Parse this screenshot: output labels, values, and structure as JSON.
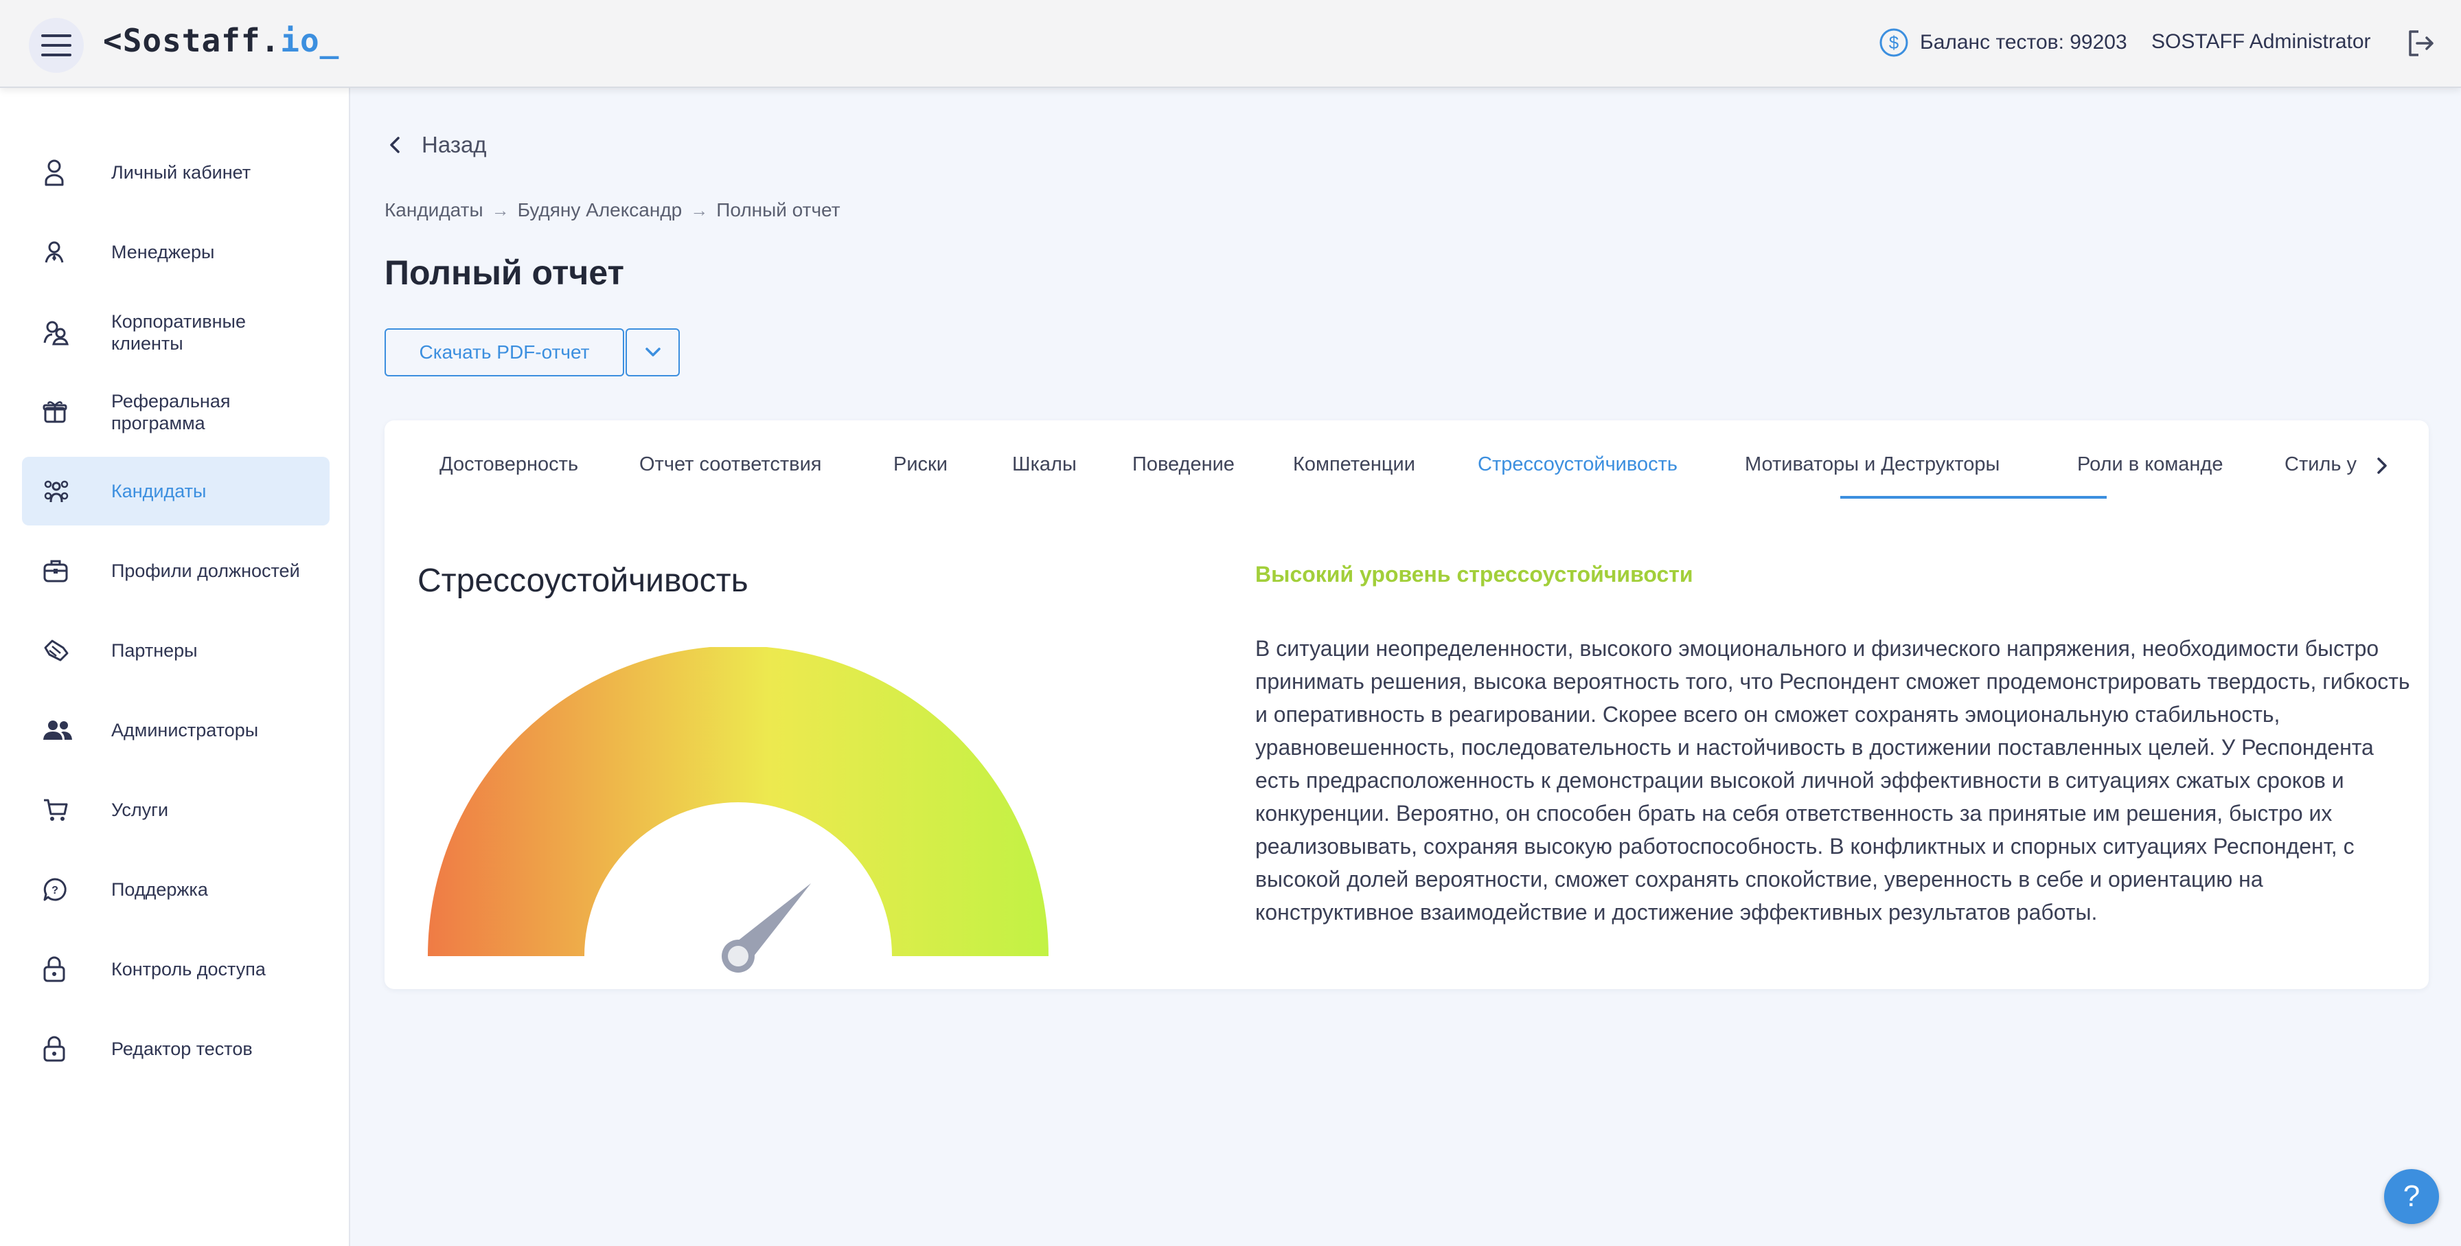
{
  "header": {
    "logo_main": "<Sostaff.",
    "logo_accent": "io_",
    "balance_label": "Баланс тестов: 99203",
    "user_name": "SOSTAFF Administrator"
  },
  "sidebar": {
    "items": [
      {
        "label": "Личный кабинет",
        "icon": "user-icon",
        "active": false
      },
      {
        "label": "Менеджеры",
        "icon": "manager-icon",
        "active": false
      },
      {
        "label": "Корпоративные клиенты",
        "icon": "clients-icon",
        "active": false
      },
      {
        "label": "Реферальная программа",
        "icon": "gift-icon",
        "active": false
      },
      {
        "label": "Кандидаты",
        "icon": "candidates-icon",
        "active": true
      },
      {
        "label": "Профили должностей",
        "icon": "briefcase-icon",
        "active": false
      },
      {
        "label": "Партнеры",
        "icon": "handshake-icon",
        "active": false
      },
      {
        "label": "Администраторы",
        "icon": "admins-icon",
        "active": false
      },
      {
        "label": "Услуги",
        "icon": "cart-icon",
        "active": false
      },
      {
        "label": "Поддержка",
        "icon": "support-icon",
        "active": false
      },
      {
        "label": "Контроль доступа",
        "icon": "lock-icon",
        "active": false
      },
      {
        "label": "Редактор тестов",
        "icon": "lock-icon",
        "active": false
      }
    ]
  },
  "main": {
    "back_label": "Назад",
    "breadcrumb": [
      "Кандидаты",
      "Будяну Александр",
      "Полный отчет"
    ],
    "page_title": "Полный отчет",
    "pdf_button": "Скачать PDF-отчет",
    "tabs": [
      {
        "label": "Достоверность",
        "active": false
      },
      {
        "label": "Отчет соответствия",
        "active": false
      },
      {
        "label": "Риски",
        "active": false
      },
      {
        "label": "Шкалы",
        "active": false
      },
      {
        "label": "Поведение",
        "active": false
      },
      {
        "label": "Компетенции",
        "active": false
      },
      {
        "label": "Стрессоустойчивость",
        "active": true
      },
      {
        "label": "Мотиваторы и Деструкторы",
        "active": false
      },
      {
        "label": "Роли в команде",
        "active": false
      },
      {
        "label": "Стиль у",
        "active": false
      }
    ],
    "section_title": "Стрессоустойчивость",
    "gauge_level": 0.75,
    "level_title": "Высокий уровень стрессоустойчивости",
    "description": "В ситуации неопределенности, высокого эмоционального и физического напряжения, необходимости быстро принимать решения, высока вероятность того, что Респондент сможет продемонстрировать твердость, гибкость и оперативность в реагировании. Скорее всего он сможет сохранять эмоциональную стабильность, уравновешенность, последовательность и настойчивость в достижении поставленных целей. У Респондента есть предрасположенность к демонстрации высокой личной эффективности в ситуациях сжатых сроков и конкуренции. Вероятно, он способен брать на себя ответственность за принятые им решения, быстро их реализовывать, сохраняя высокую работоспособность. В конфликтных и спорных ситуациях Респондент, с высокой долей вероятности, сможет сохранять спокойствие, уверенность в себе и ориентацию на конструктивное взаимодействие и достижение эффективных результатов работы."
  },
  "colors": {
    "accent": "#3c8fdf",
    "level_green": "#a2cf3a",
    "gauge_start": "#ef7b45",
    "gauge_mid": "#ede94f",
    "gauge_end": "#c2f244"
  },
  "help_label": "?"
}
